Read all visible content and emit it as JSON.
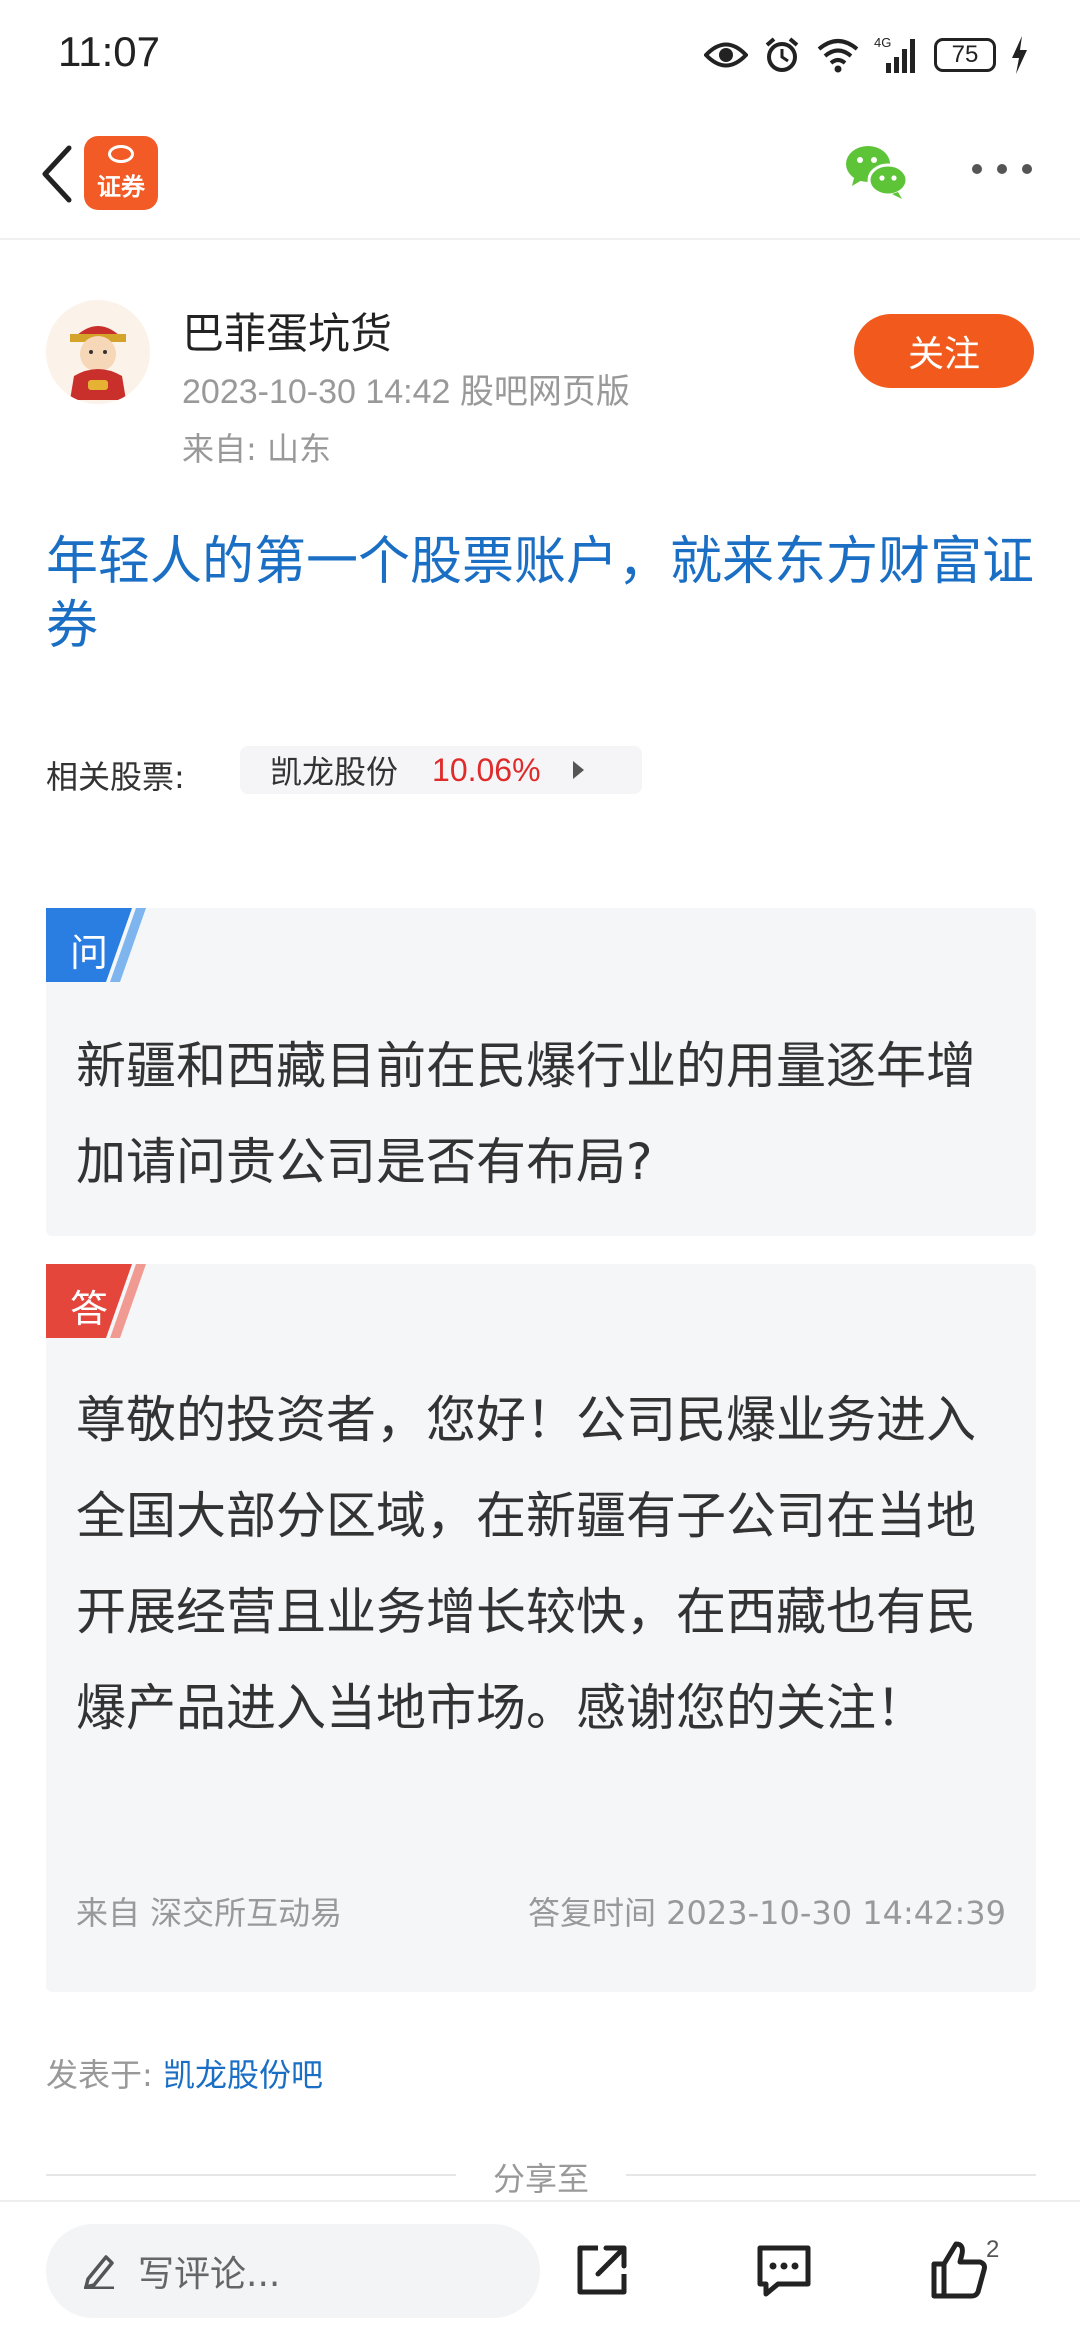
{
  "status_bar": {
    "time": "11:07",
    "battery": "75",
    "network": "4G",
    "icons": [
      "eye-icon",
      "alarm-icon",
      "wifi-icon",
      "signal-icon",
      "battery-icon",
      "charging-icon"
    ]
  },
  "nav": {
    "logo_text": "证券",
    "icons": [
      "back-arrow-icon",
      "wechat-icon",
      "more-icon"
    ]
  },
  "author": {
    "name": "巴菲蛋坑货",
    "meta": "2023-10-30 14:42 股吧网页版",
    "location": "来自: 山东",
    "follow_label": "关注"
  },
  "post": {
    "title": "年轻人的第一个股票账户，就来东方财富证券"
  },
  "related": {
    "label": "相关股票:",
    "stock_name": "凯龙股份",
    "stock_change": "10.06%"
  },
  "question": {
    "tag": "问",
    "text": "新疆和西藏目前在民爆行业的用量逐年增加请问贵公司是否有布局?"
  },
  "answer": {
    "tag": "答",
    "text": "尊敬的投资者，您好！公司民爆业务进入全国大部分区域，在新疆有子公司在当地开展经营且业务增长较快，在西藏也有民爆产品进入当地市场。感谢您的关注！",
    "source": "来自 深交所互动易",
    "reply_time": "答复时间 2023-10-30 14:42:39"
  },
  "posted_in": {
    "label": "发表于:",
    "bar_name": "凯龙股份吧"
  },
  "share": {
    "label": "分享至"
  },
  "bottom_bar": {
    "comment_placeholder": "写评论...",
    "like_count": "2",
    "icons": [
      "pencil-icon",
      "share-icon",
      "comment-icon",
      "thumbs-up-icon"
    ]
  },
  "colors": {
    "accent_orange": "#f25a1d",
    "link_blue": "#1a6fc4",
    "rise_red": "#e02b2b",
    "question_tag": "#2a7de1",
    "answer_tag": "#e4463c"
  }
}
